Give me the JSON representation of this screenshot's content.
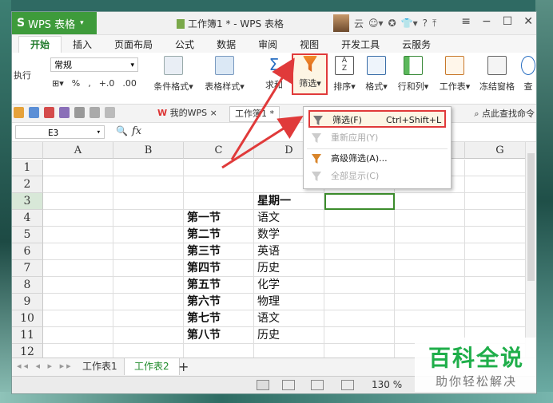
{
  "app": {
    "name": "WPS 表格",
    "logo_char": "S"
  },
  "window": {
    "title": "工作簿1 * - WPS 表格",
    "user": "云",
    "help": "?"
  },
  "menu_tabs": [
    "开始",
    "插入",
    "页面布局",
    "公式",
    "数据",
    "审阅",
    "视图",
    "开发工具",
    "云服务"
  ],
  "ribbon": {
    "left_clip": "执行",
    "number_format": "常规",
    "fmt_symbols": [
      "%",
      "‚",
      "+.0",
      ".00"
    ],
    "buttons": [
      "条件格式",
      "表格样式",
      "求和",
      "筛选",
      "排序",
      "格式",
      "行和列",
      "工作表",
      "冻结窗格",
      "查"
    ]
  },
  "quickbar": {
    "doc_tabs": [
      "我的WPS",
      "工作簿1 *"
    ],
    "search": "点此查找命令"
  },
  "formula_bar": {
    "name_box": "E3",
    "fx": "fx"
  },
  "columns": [
    "A",
    "B",
    "C",
    "D",
    "E",
    "F",
    "G"
  ],
  "rows": [
    "1",
    "2",
    "3",
    "4",
    "5",
    "6",
    "7",
    "8",
    "9",
    "10",
    "11",
    "12"
  ],
  "cells": {
    "D3": "星期一",
    "C4": "第一节",
    "D4": "语文",
    "C5": "第二节",
    "D5": "数学",
    "C6": "第三节",
    "D6": "英语",
    "C7": "第四节",
    "D7": "历史",
    "C8": "第五节",
    "D8": "化学",
    "C9": "第六节",
    "D9": "物理",
    "C10": "第七节",
    "D10": "语文",
    "C11": "第八节",
    "D11": "历史"
  },
  "filter_menu": [
    {
      "label": "筛选(F)",
      "shortcut": "Ctrl+Shift+L",
      "enabled": true
    },
    {
      "label": "重新应用(Y)",
      "shortcut": "",
      "enabled": false
    },
    {
      "label": "高级筛选(A)...",
      "shortcut": "",
      "enabled": true
    },
    {
      "label": "全部显示(C)",
      "shortcut": "",
      "enabled": false
    }
  ],
  "sheets": [
    "工作表1",
    "工作表2"
  ],
  "active_sheet": "工作表2",
  "status": {
    "zoom": "130 %"
  },
  "watermark": {
    "title": "百科全说",
    "subtitle": "助你轻松解决"
  },
  "colors": {
    "accent": "#3e9b3b",
    "highlight": "#e03a3a",
    "active_tab": "#1f8a2a"
  }
}
